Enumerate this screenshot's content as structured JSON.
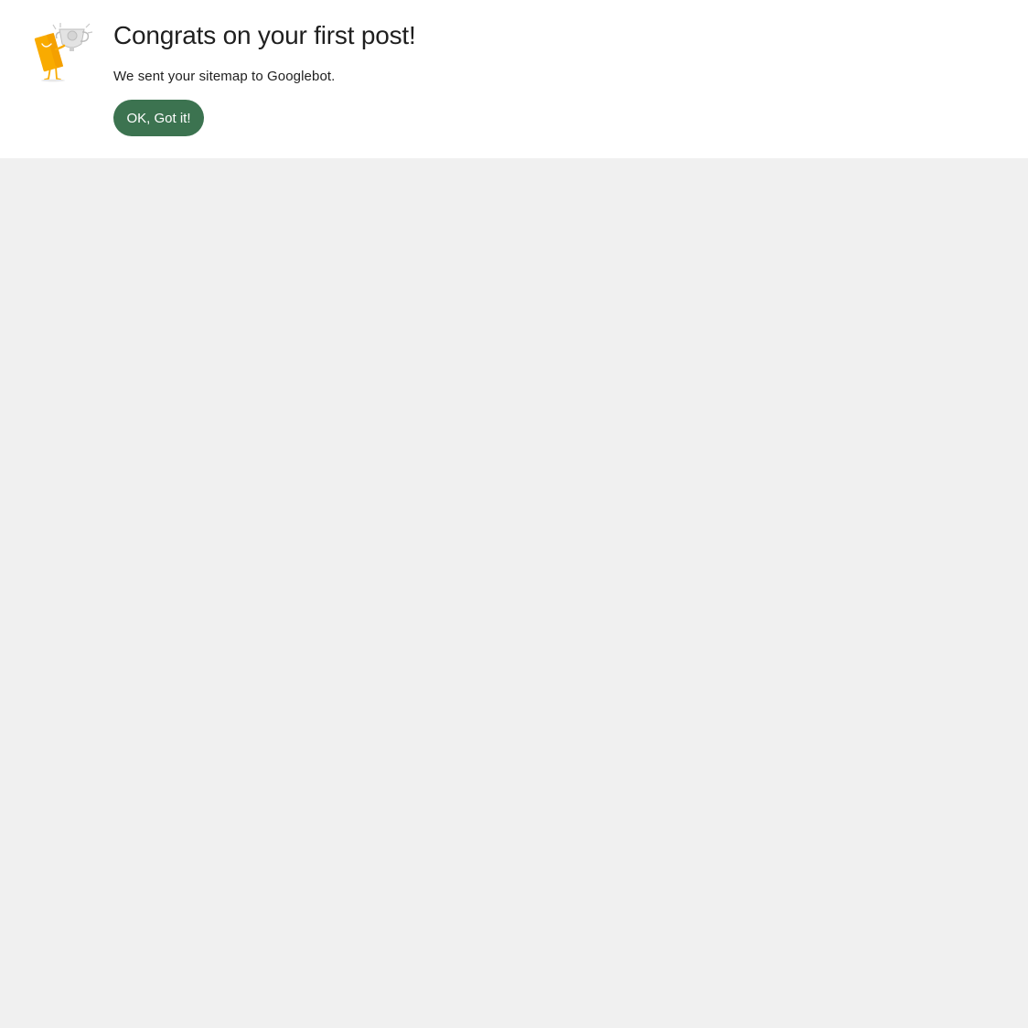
{
  "dialog": {
    "illustration_icon": "trophy-celebration-icon",
    "title": "Congrats on your first post!",
    "message": "We sent your sitemap to Googlebot.",
    "confirm_label": "OK, Got it!"
  },
  "colors": {
    "dialog_background": "#ffffff",
    "page_background": "#f0f0f0",
    "button_background": "#3c7350",
    "button_text": "#ffffff",
    "title_text": "#1f1f1f",
    "illustration_yellow": "#f9ab00"
  }
}
